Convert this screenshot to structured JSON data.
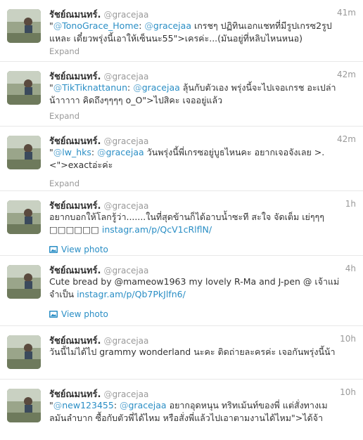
{
  "user": {
    "fullname": "รัชย์ณมนทร์.",
    "at": "@",
    "handle": "gracejaa"
  },
  "expand_label": "Expand",
  "view_photo_label": "View photo",
  "tweets": [
    {
      "time": "41m",
      "mention_at": "@",
      "mention_name": "TonoGrace_Home",
      "colon": ": ",
      "mention2_at": "@",
      "mention2_name": "gracejaa",
      "body_line1_rest": " เกรชๆ ปฏิทินเอกแชทที่มีรูปเกรซ2รูป",
      "body_line2": "แหละ เดี๋ยวพรุ่งนี้เอาให้เซ็นนะ55\">เครค่ะ...(มันอยู่ที่หลิบไหนหนอ)",
      "quote_open": "\""
    },
    {
      "time": "42m",
      "mention_at": "@",
      "mention_name": "TikTiknattanun",
      "colon": ": ",
      "mention2_at": "@",
      "mention2_name": "gracejaa",
      "body_line1_rest": " ลุ้นกับตัวเอง พรุ่งนี้จะไปเจอเกรช อะเปล่า",
      "body_line2": "น้าาาาา คิดถึงๆๆๆๆ o_O\">ไปสิคะ เจออยู่แล้ว",
      "quote_open": "\""
    },
    {
      "time": "42m",
      "mention_at": "@",
      "mention_name": "lw_hks",
      "colon": ": ",
      "mention2_at": "@",
      "mention2_name": "gracejaa",
      "body_line1_rest": " วันพรุ่งนี้พี่เกรซอยู่บูธไหนคะ อยากเจอจังเลย >.",
      "body_line2": "<\">exactอ่ะค่ะ",
      "quote_open": "\""
    },
    {
      "time": "1h",
      "body_line1": "อยากบอกให้โลกรู้ว่า.......ในที่สุดข้านก็ได้อาบน้ำซะที สะใจ จัดเต็ม เย่ๆๆๆ",
      "body_line2_prefix": "□□□□□□ ",
      "link": "instagr.am/p/QcV1cRlflN/"
    },
    {
      "time": "4h",
      "body_line1": "Cute bread by @mameow1963 my lovely R-Ma and J-pen @ เจ้าแม่",
      "body_line2_prefix": "จำเป็น ",
      "link": "instagr.am/p/Qb7PkJlfn6/"
    },
    {
      "time": "10h",
      "body_line1": "วันนี้ไม่ได้ไป grammy wonderland นะคะ ติดถ่ายละครค่ะ เจอกันพรุ่งนี้น้า"
    },
    {
      "time": "10h",
      "mention_at": "@",
      "mention_name": "new123455",
      "colon": ": ",
      "mention2_at": "@",
      "mention2_name": "gracejaa",
      "body_line1_rest": " อยากอุดหนุน ทริทเม้นท์ของพี่ แต่สั่งทางเม",
      "body_line2": "ลมันลำบาก ซื้อกับตัวพี่ได้ไหม หรือสั่งพี่แล้วไปเอาตามงานได้ไหม\">ได้จ้า",
      "quote_open": "\""
    }
  ]
}
